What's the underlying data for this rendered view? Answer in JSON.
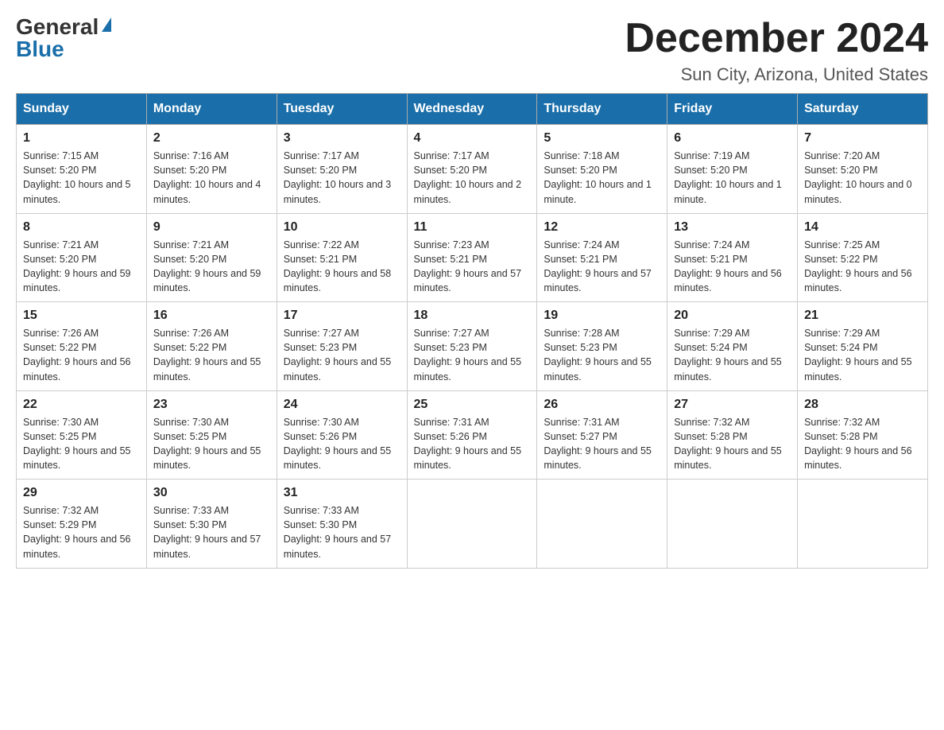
{
  "logo": {
    "general": "General",
    "blue": "Blue"
  },
  "title": "December 2024",
  "subtitle": "Sun City, Arizona, United States",
  "days_header": [
    "Sunday",
    "Monday",
    "Tuesday",
    "Wednesday",
    "Thursday",
    "Friday",
    "Saturday"
  ],
  "weeks": [
    [
      {
        "day": "1",
        "sunrise": "7:15 AM",
        "sunset": "5:20 PM",
        "daylight": "10 hours and 5 minutes."
      },
      {
        "day": "2",
        "sunrise": "7:16 AM",
        "sunset": "5:20 PM",
        "daylight": "10 hours and 4 minutes."
      },
      {
        "day": "3",
        "sunrise": "7:17 AM",
        "sunset": "5:20 PM",
        "daylight": "10 hours and 3 minutes."
      },
      {
        "day": "4",
        "sunrise": "7:17 AM",
        "sunset": "5:20 PM",
        "daylight": "10 hours and 2 minutes."
      },
      {
        "day": "5",
        "sunrise": "7:18 AM",
        "sunset": "5:20 PM",
        "daylight": "10 hours and 1 minute."
      },
      {
        "day": "6",
        "sunrise": "7:19 AM",
        "sunset": "5:20 PM",
        "daylight": "10 hours and 1 minute."
      },
      {
        "day": "7",
        "sunrise": "7:20 AM",
        "sunset": "5:20 PM",
        "daylight": "10 hours and 0 minutes."
      }
    ],
    [
      {
        "day": "8",
        "sunrise": "7:21 AM",
        "sunset": "5:20 PM",
        "daylight": "9 hours and 59 minutes."
      },
      {
        "day": "9",
        "sunrise": "7:21 AM",
        "sunset": "5:20 PM",
        "daylight": "9 hours and 59 minutes."
      },
      {
        "day": "10",
        "sunrise": "7:22 AM",
        "sunset": "5:21 PM",
        "daylight": "9 hours and 58 minutes."
      },
      {
        "day": "11",
        "sunrise": "7:23 AM",
        "sunset": "5:21 PM",
        "daylight": "9 hours and 57 minutes."
      },
      {
        "day": "12",
        "sunrise": "7:24 AM",
        "sunset": "5:21 PM",
        "daylight": "9 hours and 57 minutes."
      },
      {
        "day": "13",
        "sunrise": "7:24 AM",
        "sunset": "5:21 PM",
        "daylight": "9 hours and 56 minutes."
      },
      {
        "day": "14",
        "sunrise": "7:25 AM",
        "sunset": "5:22 PM",
        "daylight": "9 hours and 56 minutes."
      }
    ],
    [
      {
        "day": "15",
        "sunrise": "7:26 AM",
        "sunset": "5:22 PM",
        "daylight": "9 hours and 56 minutes."
      },
      {
        "day": "16",
        "sunrise": "7:26 AM",
        "sunset": "5:22 PM",
        "daylight": "9 hours and 55 minutes."
      },
      {
        "day": "17",
        "sunrise": "7:27 AM",
        "sunset": "5:23 PM",
        "daylight": "9 hours and 55 minutes."
      },
      {
        "day": "18",
        "sunrise": "7:27 AM",
        "sunset": "5:23 PM",
        "daylight": "9 hours and 55 minutes."
      },
      {
        "day": "19",
        "sunrise": "7:28 AM",
        "sunset": "5:23 PM",
        "daylight": "9 hours and 55 minutes."
      },
      {
        "day": "20",
        "sunrise": "7:29 AM",
        "sunset": "5:24 PM",
        "daylight": "9 hours and 55 minutes."
      },
      {
        "day": "21",
        "sunrise": "7:29 AM",
        "sunset": "5:24 PM",
        "daylight": "9 hours and 55 minutes."
      }
    ],
    [
      {
        "day": "22",
        "sunrise": "7:30 AM",
        "sunset": "5:25 PM",
        "daylight": "9 hours and 55 minutes."
      },
      {
        "day": "23",
        "sunrise": "7:30 AM",
        "sunset": "5:25 PM",
        "daylight": "9 hours and 55 minutes."
      },
      {
        "day": "24",
        "sunrise": "7:30 AM",
        "sunset": "5:26 PM",
        "daylight": "9 hours and 55 minutes."
      },
      {
        "day": "25",
        "sunrise": "7:31 AM",
        "sunset": "5:26 PM",
        "daylight": "9 hours and 55 minutes."
      },
      {
        "day": "26",
        "sunrise": "7:31 AM",
        "sunset": "5:27 PM",
        "daylight": "9 hours and 55 minutes."
      },
      {
        "day": "27",
        "sunrise": "7:32 AM",
        "sunset": "5:28 PM",
        "daylight": "9 hours and 55 minutes."
      },
      {
        "day": "28",
        "sunrise": "7:32 AM",
        "sunset": "5:28 PM",
        "daylight": "9 hours and 56 minutes."
      }
    ],
    [
      {
        "day": "29",
        "sunrise": "7:32 AM",
        "sunset": "5:29 PM",
        "daylight": "9 hours and 56 minutes."
      },
      {
        "day": "30",
        "sunrise": "7:33 AM",
        "sunset": "5:30 PM",
        "daylight": "9 hours and 57 minutes."
      },
      {
        "day": "31",
        "sunrise": "7:33 AM",
        "sunset": "5:30 PM",
        "daylight": "9 hours and 57 minutes."
      },
      null,
      null,
      null,
      null
    ]
  ]
}
